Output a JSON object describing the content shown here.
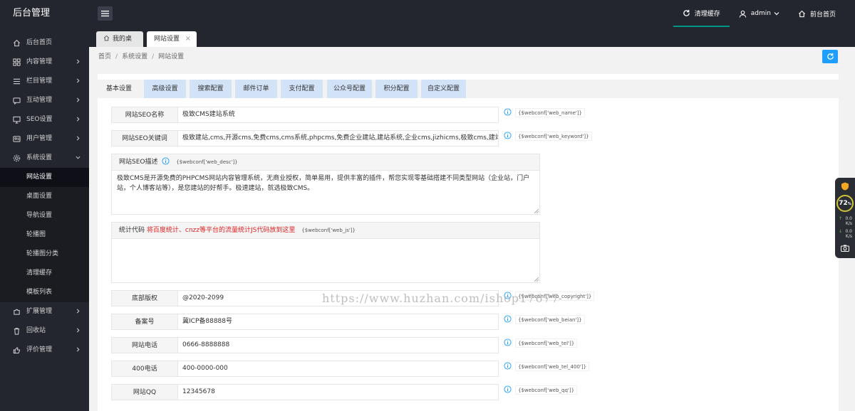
{
  "app": {
    "title": "后台管理"
  },
  "topbar": {
    "items": [
      {
        "label": "清理缓存",
        "icon": "refresh-icon"
      },
      {
        "label": "admin",
        "icon": "user-icon"
      },
      {
        "label": "前台首页",
        "icon": "home-icon"
      }
    ],
    "accent": "#009688"
  },
  "sidebar": {
    "items": [
      {
        "label": "后台首页",
        "icon": "home-icon"
      },
      {
        "label": "内容管理",
        "icon": "grid-icon"
      },
      {
        "label": "栏目管理",
        "icon": "list-icon"
      },
      {
        "label": "互动管理",
        "icon": "chat-icon"
      },
      {
        "label": "SEO设置",
        "icon": "monitor-icon"
      },
      {
        "label": "用户管理",
        "icon": "users-icon"
      },
      {
        "label": "系统设置",
        "icon": "gear-icon"
      }
    ],
    "sub_items": [
      "网站设置",
      "桌面设置",
      "导航设置",
      "轮播图",
      "轮播图分类",
      "清理缓存",
      "模板列表"
    ],
    "items_after": [
      {
        "label": "扩展管理",
        "icon": "puzzle-icon"
      },
      {
        "label": "回收站",
        "icon": "trash-icon"
      },
      {
        "label": "评价管理",
        "icon": "thumb-icon"
      }
    ]
  },
  "tabs": [
    {
      "label": "我的桌面"
    },
    {
      "label": "网站设置",
      "close": "×"
    }
  ],
  "breadcrumb": [
    "首页",
    "系统设置",
    "网站设置"
  ],
  "breadcrumb_sep": "/",
  "settings_tabs": [
    "基本设置",
    "高级设置",
    "搜索配置",
    "邮件订单",
    "支付配置",
    "公众号配置",
    "积分配置",
    "自定义配置"
  ],
  "fields": {
    "seo_name": {
      "label": "网站SEO名称",
      "value": "极致CMS建站系统",
      "hint": "{$webconf['web_name']}"
    },
    "seo_keyword": {
      "label": "网站SEO关键词",
      "value": "极致建站,cms,开源cms,免费cms,cms系统,phpcms,免费企业建站,建站系统,企业cms,jizhicms,极致cms,建站cms,建站",
      "hint": "{$webconf['web_keyword']}"
    },
    "seo_desc": {
      "label": "网站SEO描述",
      "hint": "{$webconf['web_desc']}",
      "value": "极致CMS是开源免费的PHPCMS网站内容管理系统，无商业授权，简单易用，提供丰富的插件，帮您实现零基础搭建不同类型网站（企业站，门户站，个人博客站等），是您建站的好帮手。极速建站，就选极致CMS。"
    },
    "stats_code": {
      "label": "统计代码",
      "note": "将百度统计、cnzz等平台的流量统计JS代码放到这里",
      "hint": "{$webconf['web_js']}",
      "value": ""
    },
    "copyright": {
      "label": "底部版权",
      "value": "@2020-2099",
      "hint": "{$webconf['web_copyright']}"
    },
    "beian": {
      "label": "备案号",
      "value": "冀ICP备88888号",
      "hint": "{$webconf['web_beian']}"
    },
    "tel": {
      "label": "网站电话",
      "value": "0666-8888888",
      "hint": "{$webconf['web_tel']}"
    },
    "tel400": {
      "label": "400电话",
      "value": "400-0000-000",
      "hint": "{$webconf['web_tel_400']}"
    },
    "qq": {
      "label": "网站QQ",
      "value": "12345678",
      "hint": "{$webconf['web_qq']}"
    }
  },
  "watermark": "https://www.huzhan.com/ishop17677",
  "float_widget": {
    "score": "72",
    "score_unit": "%",
    "up": "0.0",
    "up_unit": "K/s",
    "down": "0.0",
    "down_unit": "K/s"
  }
}
